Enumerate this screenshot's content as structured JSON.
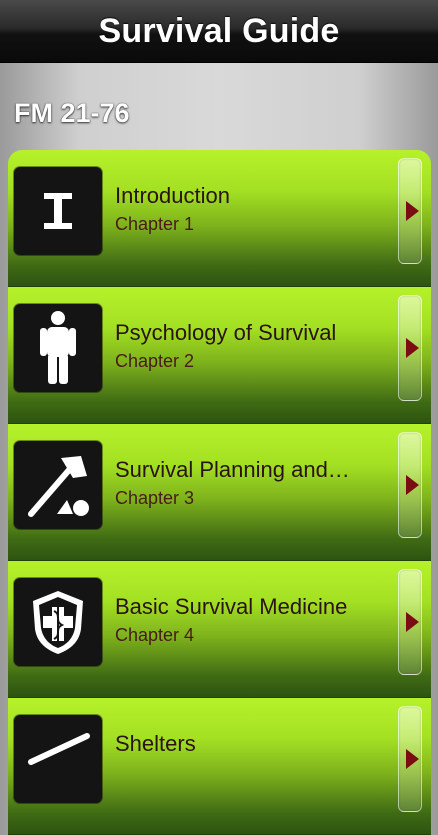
{
  "navbar": {
    "title": "Survival Guide"
  },
  "section": {
    "header": "FM 21-76"
  },
  "chapters": [
    {
      "title": "Introduction",
      "subtitle": "Chapter 1",
      "icon": "letter-i-icon"
    },
    {
      "title": "Psychology of Survival",
      "subtitle": "Chapter 2",
      "icon": "person-icon"
    },
    {
      "title": "Survival Planning and…",
      "subtitle": "Chapter 3",
      "icon": "axe-icon"
    },
    {
      "title": "Basic Survival Medicine",
      "subtitle": "Chapter 4",
      "icon": "medical-shield-icon"
    },
    {
      "title": "Shelters",
      "subtitle": "",
      "icon": "shelter-icon"
    }
  ],
  "colors": {
    "accent_green": "#a3e023",
    "dark_green": "#2d5410",
    "arrow_red": "#7a0c12"
  }
}
